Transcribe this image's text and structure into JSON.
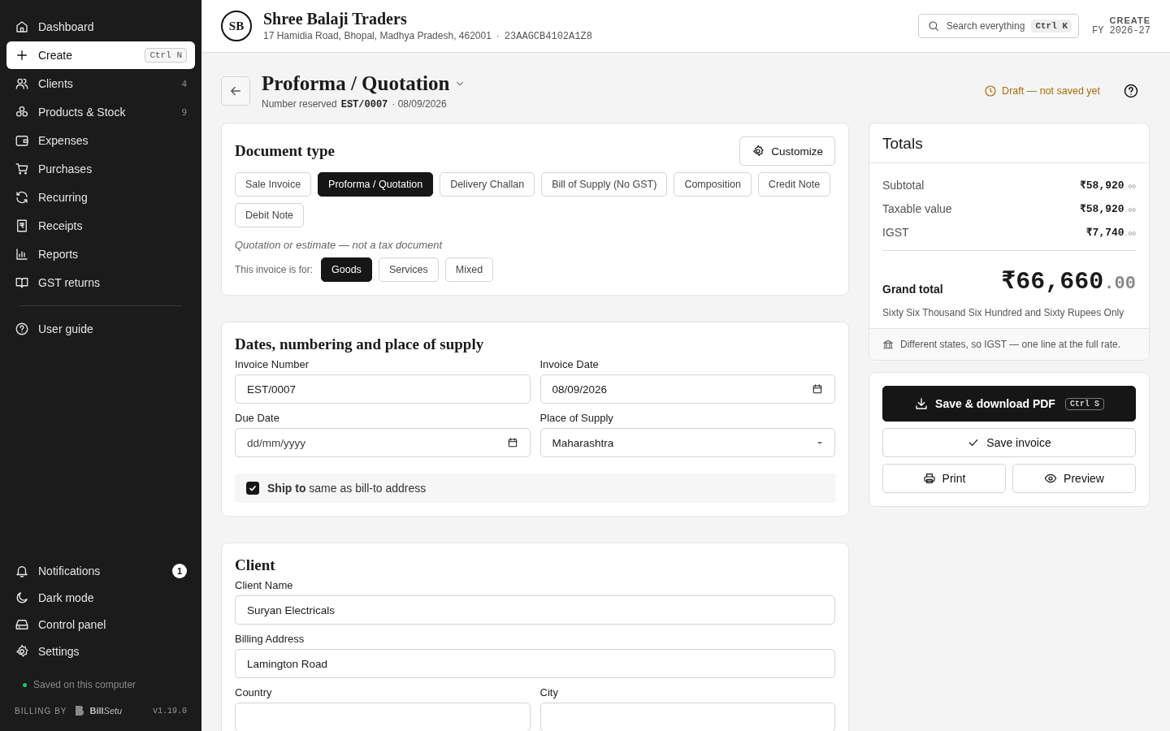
{
  "sidebar": {
    "items": [
      {
        "label": "Dashboard",
        "selected": false
      },
      {
        "label": "Create",
        "selected": true,
        "shortcut": "Ctrl N"
      },
      {
        "label": "Clients",
        "selected": false,
        "count": "4"
      },
      {
        "label": "Products & Stock",
        "selected": false,
        "count": "9"
      },
      {
        "label": "Expenses",
        "selected": false
      },
      {
        "label": "Purchases",
        "selected": false
      },
      {
        "label": "Recurring",
        "selected": false
      },
      {
        "label": "Receipts",
        "selected": false
      },
      {
        "label": "Reports",
        "selected": false
      },
      {
        "label": "GST returns",
        "selected": false
      }
    ],
    "help": {
      "label": "User guide"
    },
    "bottom_items": [
      {
        "label": "Notifications",
        "badge": "1"
      },
      {
        "label": "Dark mode"
      },
      {
        "label": "Control panel"
      },
      {
        "label": "Settings"
      }
    ],
    "status": "Saved on this computer",
    "footer": {
      "billing_by": "BILLING BY",
      "brand": {
        "bold": "Bill",
        "italic": "Setu"
      },
      "version": "v1.19.0"
    }
  },
  "header": {
    "avatar": "SB",
    "business": "Shree Balaji Traders",
    "address": "17 Hamidia Road, Bhopal, Madhya Pradesh, 462001",
    "separator": "·",
    "gstin": "23AAGCB4102A1Z8",
    "search": {
      "placeholder": "Search everything",
      "shortcut": "Ctrl K"
    },
    "fy_label": "CREATE",
    "fy": "FY 2026-27"
  },
  "page": {
    "title": "Proforma / Quotation",
    "reserved_label": "Number reserved",
    "number": "EST/0007",
    "date": "· 08/09/2026",
    "status": "Draft — not saved yet"
  },
  "document_type": {
    "title": "Document type",
    "customize": "Customize",
    "types": [
      {
        "label": "Sale Invoice",
        "selected": false
      },
      {
        "label": "Proforma / Quotation",
        "selected": true
      },
      {
        "label": "Delivery Challan",
        "selected": false
      },
      {
        "label": "Bill of Supply (No GST)",
        "selected": false
      },
      {
        "label": "Composition",
        "selected": false
      },
      {
        "label": "Credit Note",
        "selected": false
      },
      {
        "label": "Debit Note",
        "selected": false
      }
    ],
    "note": "Quotation or estimate — not a tax document",
    "for_label": "This invoice is for:",
    "for_options": [
      {
        "label": "Goods",
        "selected": true
      },
      {
        "label": "Services",
        "selected": false
      },
      {
        "label": "Mixed",
        "selected": false
      }
    ]
  },
  "dates": {
    "title": "Dates, numbering and place of supply",
    "fields": [
      {
        "label": "Invoice Number",
        "kind": "text",
        "value": "EST/0007"
      },
      {
        "label": "Invoice Date",
        "kind": "date",
        "value": "08/09/2026"
      },
      {
        "label": "Due Date",
        "kind": "date",
        "placeholder": "dd/mm/yyyy"
      },
      {
        "label": "Place of Supply",
        "kind": "select",
        "value": "Maharashtra"
      }
    ],
    "ship_to": {
      "checked": true,
      "label": "**Ship to** same as bill-to address"
    }
  },
  "client": {
    "title": "Client",
    "fields": [
      {
        "label": "Client Name",
        "value": "Suryan Electricals",
        "wide": true
      },
      {
        "label": "Billing Address",
        "value": "Lamington Road",
        "wide": true
      },
      {
        "label": "Country"
      },
      {
        "label": "City"
      }
    ]
  },
  "totals": {
    "title": "Totals",
    "rows": [
      {
        "label": "Subtotal",
        "amount": "₹58,920",
        "decimals": ".00"
      },
      {
        "label": "Taxable value",
        "amount": "₹58,920",
        "decimals": ".00"
      },
      {
        "label": "IGST",
        "amount": "₹7,740",
        "decimals": ".00"
      }
    ],
    "grand_label": "Grand total",
    "grand_amount": "₹66,660",
    "grand_decimals": ".00",
    "words": "Sixty Six Thousand Six Hundred and Sixty Rupees Only",
    "note": "Different states, so IGST — one line at the full rate."
  },
  "actions": {
    "primary": "Save & download PDF",
    "primary_shortcut": "Ctrl S",
    "save": "Save invoice",
    "print": "Print",
    "preview": "Preview"
  }
}
